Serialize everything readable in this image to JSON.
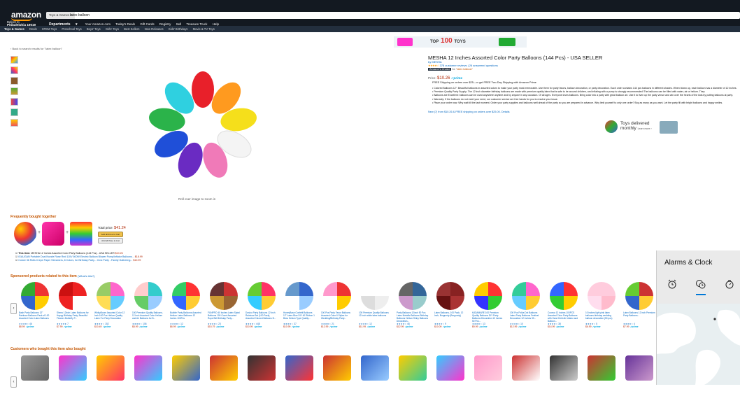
{
  "header": {
    "logo_text": "amazon",
    "search_category": "Toys & Games",
    "search_query": "latex balloon",
    "deliver_label": "Deliver to",
    "deliver_location": "Philadelphia 19019",
    "departments_label": "Departments",
    "nav_links": [
      "Your Amazon.com",
      "Today's Deals",
      "Gift Cards",
      "Registry",
      "Sell",
      "Treasure Truck",
      "Help"
    ]
  },
  "subnav": [
    "Toys & Games",
    "Deals",
    "STEM Toys",
    "Preschool Toys",
    "Boys' Toys",
    "Girls' Toys",
    "Best Sellers",
    "New Releases",
    "Kids' Birthdays",
    "Movie & TV Toys"
  ],
  "back_link": "‹ Back to search results for \"latex balloon\"",
  "image_hint": "Roll over image to zoom in",
  "banner": {
    "brand": "TOP",
    "number": "100",
    "word": "TOYS"
  },
  "product": {
    "title": "MESHA 12 Inches Assorted Color Party Balloons (144 Pcs) - USA SELLER",
    "by": "by MESHA",
    "stars": "★★★★☆",
    "reviews": "378 customer reviews",
    "answered": "26 answered questions",
    "choice_badge": "Amazon's Choice",
    "choice_for": "for",
    "choice_keyword": "\"latex balloon\"",
    "price_label": "Price:",
    "price": "$10.26",
    "prime": "✓prime",
    "shipping": "FREE Shipping on orders over $25—or get FREE Two-Day Shipping with Amazon Prime",
    "bullets": [
      "Colored Balloons 12\": Beautiful balloons in assorted colors to make your party most memorable. Use them for party favors, balloon decoration, or party decoration. Each order contains 144 pcs balloons in different shades. When blown up, each balloon has a diameter of 12 inches.",
      "Premium Quality Party Supply: The 12 inch diameter birthday balloons are made with premium quality latex that is safe to be around children, and inflating with a pump is strongly recommended! The balloons can be filled with water, air or helium. They",
      "Balloons are Excellent: balloons can be used anywhere anytime and by anyone in any occasion. Of all ages. Everyone loves balloons. Bring color into a party with great balloon art. Use it to liven up the party venue and win over the hearts of the kids by putting balloons at party.",
      "Warranty: If the balloons do not meet your need, our customer service are free hands for you to resolve your issue.",
      "Place your order now: Why wait till the last moment. Order your party supplies and balloons well ahead of the party so you are prepared in advance. Why limit yourself to only one order? Buy as many as you want. Let the party fill with bright balloons and happy smiles."
    ],
    "new_from": "New (7) from $10.26 & FREE shipping on orders over $25.00. Details"
  },
  "toys_delivered": {
    "line1": "Toys delivered",
    "line2": "monthly",
    "learn": "Learn more ›"
  },
  "fbt": {
    "title": "Frequently bought together",
    "total_label": "Total price:",
    "total": "$41.24",
    "btn_cart": "Add all three to Cart",
    "btn_list": "Add all three to List",
    "items": [
      {
        "prefix": "This item:",
        "name": "MESHA 12 Inches Assorted Color Party Balloons (144 Pcs) - USA SELLER",
        "price": "$10.26"
      },
      {
        "prefix": "",
        "name": "iGAUGAN Portable Dual Nozzle Rose Red 110V 600W Electric Balloon Blower Pump/Inflator Balloons...",
        "price": "$18.99"
      },
      {
        "prefix": "",
        "name": "Colore 36 Rolls Crepe Paper Streamers, 6 Colors, for Birthday Party... Civic Party - Family Gathering...",
        "price": "$10.99"
      }
    ]
  },
  "sponsored": {
    "title": "Sponsored products related to this item",
    "whats_this": "(What's this?)",
    "cards": [
      {
        "title": "Bash Party Balloons 12\" Rainbow Balloons Pack of 100 Assorted Color Latex Balloons",
        "rating": "★★★★☆ 46",
        "price": "$8.99",
        "colors": [
          "#e33",
          "#fc0",
          "#36c",
          "#3a3"
        ]
      },
      {
        "title": "Shenc 12inch Latex Balloons for Happy Birthday Party, Beautiful Flowers Butterfly P...",
        "rating": "★★★★★ 7",
        "price": "$7.99",
        "colors": [
          "#e22",
          "#fff",
          "#e22",
          "#c11"
        ]
      },
      {
        "title": "WhikyBoom Assorted Color 12 Inch 100 Pcs Helium Quality Latex For Party Decoration",
        "rating": "★★★★☆ 152",
        "price": "$10.49",
        "colors": [
          "#f6c",
          "#6cf",
          "#fd5",
          "#9c6"
        ]
      },
      {
        "title": "100 Premium Quality Balloons, 12 Inch Assorted Color Helium and Air Balloons for B...",
        "rating": "★★★★☆ 106",
        "price": "$8.99",
        "colors": [
          "#3cc",
          "#9cf",
          "#6c6",
          "#fcc"
        ]
      },
      {
        "title": "Bubble Party Balloons Assorted Helium Latex Balloons 12 Inches 100Pcs",
        "rating": "★★★★☆ 12",
        "price": "$6.99",
        "colors": [
          "#f33",
          "#fc3",
          "#36f",
          "#3c6"
        ]
      },
      {
        "title": "FUNPRO 40 Inches Latex Spiral Balloons 100 Count Assorted Rope Birt Birthday Party...",
        "rating": "★★★★☆ 23",
        "price": "$15.79",
        "colors": [
          "#c33",
          "#963",
          "#c93",
          "#633"
        ]
      },
      {
        "title": "Dusico Party Balloons 12 Inch Rainbow Set (100 Pack), Assorted Colored Balloons B...",
        "rating": "★★★★☆ 448",
        "price": "$10.99",
        "colors": [
          "#f36",
          "#fc3",
          "#3cf",
          "#6c3"
        ]
      },
      {
        "title": "HoneyBase Confetti Balloons 12\" Latex Blue DIY 40 Ribbon 1 Blow Helium Type Quality...",
        "rating": "★★★★☆ 37",
        "price": "$10.99",
        "colors": [
          "#36c",
          "#9cf",
          "#fff",
          "#69c"
        ]
      },
      {
        "title": "100 Pcs Party Favor Balloons Assorted Color 6 Styles for Wedding/Birthday Party...",
        "rating": "★★★★☆ 21",
        "price": "$12.99",
        "colors": [
          "#e33",
          "#fc0",
          "#fff",
          "#f9c"
        ]
      },
      {
        "title": "100 Premium Quality Balloons 12 Inch white latex balloons",
        "rating": "★★★★☆ 12",
        "price": "$11.99",
        "colors": [
          "#fff",
          "#eee",
          "#ddd",
          "#fff"
        ]
      },
      {
        "title": "Party Balloons 12inch 50 Pcs Latex Metallic Balloons Birthday Balloons Helium Shiny Balloons Decoration...",
        "rating": "★★★★☆ 46",
        "price": "$12.99",
        "colors": [
          "#369",
          "#9cc",
          "#c9c",
          "#666"
        ]
      },
      {
        "title": "Latex Balloons, 100 Pack, 12 Inch, Burgundy (Burgundy)",
        "rating": "★★★★☆ 9",
        "price": "$10.09",
        "colors": [
          "#822",
          "#a33",
          "#611",
          "#933"
        ]
      },
      {
        "title": "KADAMARE 100 Premium Quality Balloons DIY Party Balloons Decoration 10 Inches 50 Pcs...",
        "rating": "★★★★☆ 13",
        "price": "$9.99",
        "colors": [
          "#f33",
          "#3c3",
          "#33f",
          "#fc0"
        ]
      },
      {
        "title": "100 Pcs Polka Dot Balloons Latex Party Balloons Festival Decoration 12 Inches 33...",
        "rating": "★★★★☆ 10",
        "price": "$12.99",
        "colors": [
          "#f6c",
          "#fc3",
          "#6cf",
          "#3c9"
        ]
      },
      {
        "title": "Coceca 12 Inches 100PCS Assorted Color Party Balloons with Hand Held Air Inflator and Balloon...",
        "rating": "★★★★☆ 38",
        "price": "$14.99",
        "colors": [
          "#f33",
          "#fc0",
          "#3c3",
          "#36f"
        ]
      },
      {
        "title": "10 inches light pink latex balloons birthday wedding balloon decoration (50 pcs)",
        "rating": "★★★★☆ 5",
        "price": "$6.99",
        "colors": [
          "#fcd",
          "#fbc",
          "#fde",
          "#fcd"
        ]
      },
      {
        "title": "Latex Balloons 12 inch Premium Party Balloons...",
        "rating": "★★★★☆ 4",
        "price": "$7.99",
        "colors": [
          "#c33",
          "#fc3",
          "#36c",
          "#6c3"
        ]
      }
    ]
  },
  "also_bought": {
    "title": "Customers who bought this item also bought",
    "cards": [
      {
        "colors": [
          "#999",
          "#666"
        ]
      },
      {
        "colors": [
          "#f3c",
          "#3cf"
        ]
      },
      {
        "colors": [
          "#fc0",
          "#f36"
        ]
      },
      {
        "colors": [
          "#f3c",
          "#3cf"
        ]
      },
      {
        "colors": [
          "#fc0",
          "#36c"
        ]
      },
      {
        "colors": [
          "#c33",
          "#fc0"
        ]
      },
      {
        "colors": [
          "#333",
          "#c33"
        ]
      },
      {
        "colors": [
          "#36c",
          "#f33"
        ]
      },
      {
        "colors": [
          "#c33",
          "#fc0"
        ]
      },
      {
        "colors": [
          "#36c",
          "#9cf"
        ]
      },
      {
        "colors": [
          "#fc0",
          "#3c9"
        ]
      },
      {
        "colors": [
          "#3cf",
          "#f3c"
        ]
      },
      {
        "colors": [
          "#f9c",
          "#fcd"
        ]
      },
      {
        "colors": [
          "#c33",
          "#fff"
        ]
      },
      {
        "colors": [
          "#333",
          "#ccc"
        ]
      },
      {
        "colors": [
          "#c33",
          "#3c3"
        ]
      },
      {
        "colors": [
          "#639",
          "#c9c"
        ]
      }
    ]
  },
  "alarms": {
    "title": "Alarms & Clock"
  },
  "colors": {
    "topbar": "#131921",
    "subnav": "#232f3e",
    "accent": "#f90",
    "link": "#0066c0",
    "price": "#b12704",
    "section": "#c45500"
  }
}
